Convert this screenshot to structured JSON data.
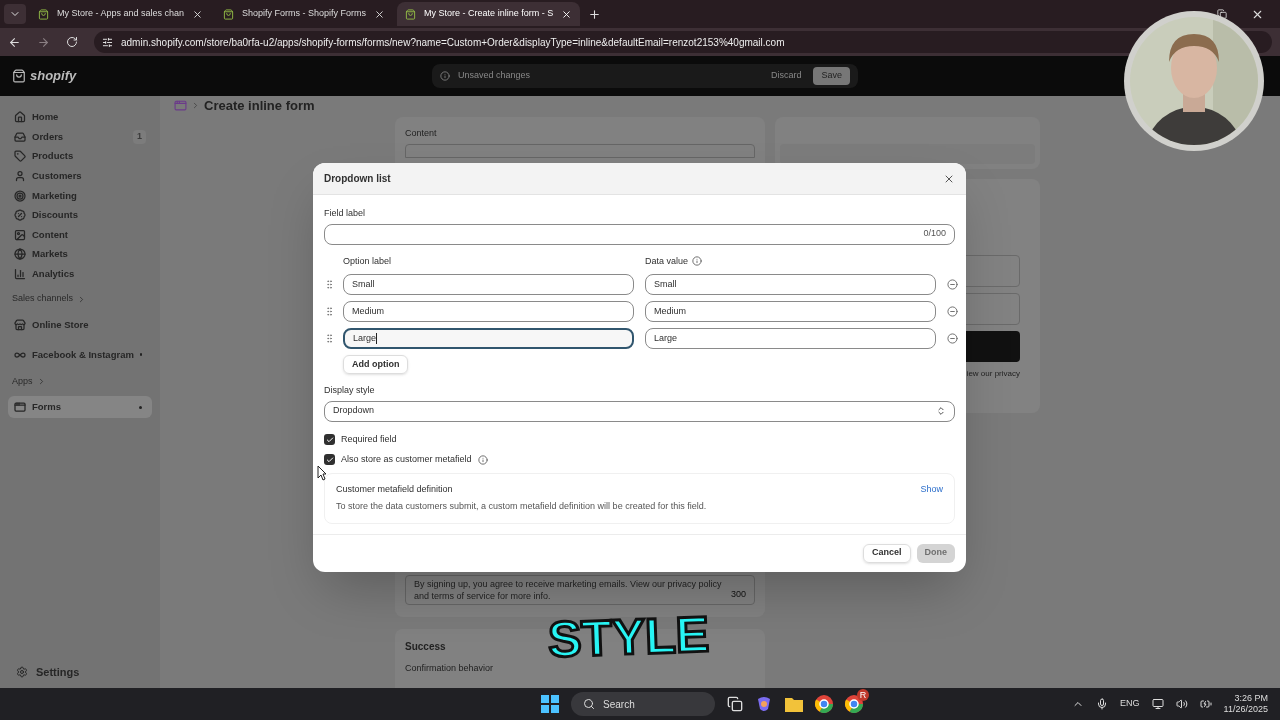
{
  "browser": {
    "tabs": [
      {
        "title": "My Store - Apps and sales chan",
        "selected": false
      },
      {
        "title": "Shopify Forms - Shopify Forms",
        "selected": false
      },
      {
        "title": "My Store - Create inline form - S",
        "selected": true
      }
    ],
    "url": "admin.shopify.com/store/ba0rfa-u2/apps/shopify-forms/forms/new?name=Custom+Order&displayType=inline&defaultEmail=renzot2153%40gmail.com"
  },
  "topbar": {
    "logo": "shopify",
    "status": "Unsaved changes",
    "discard": "Discard",
    "save": "Save"
  },
  "sidebar": {
    "items": [
      {
        "label": "Home",
        "selected": false
      },
      {
        "label": "Orders",
        "badge": "1",
        "selected": false
      },
      {
        "label": "Products",
        "selected": false
      },
      {
        "label": "Customers",
        "selected": false
      },
      {
        "label": "Marketing",
        "selected": false
      },
      {
        "label": "Discounts",
        "selected": false
      },
      {
        "label": "Content",
        "selected": false
      },
      {
        "label": "Markets",
        "selected": false
      },
      {
        "label": "Analytics",
        "selected": false
      }
    ],
    "sections": [
      {
        "heading": "Sales channels",
        "items": [
          {
            "label": "Online Store",
            "dot": false,
            "selected": false
          },
          {
            "label": "Facebook & Instagram",
            "dot": true,
            "selected": false
          }
        ]
      },
      {
        "heading": "Apps",
        "items": [
          {
            "label": "Forms",
            "dot": true,
            "selected": true
          }
        ]
      }
    ],
    "settings": "Settings"
  },
  "page": {
    "title": "Create inline form",
    "content_label": "Content",
    "disclaimer": "By signing up, you agree to receive marketing emails. View our privacy policy and terms of service for more info.",
    "counter": "300",
    "success_title": "Success",
    "success_label": "Confirmation behavior",
    "preview_text": "iew our privacy"
  },
  "modal": {
    "title": "Dropdown list",
    "field_label": {
      "label": "Field label",
      "counter": "0/100"
    },
    "columns": [
      "Option label",
      "Data value"
    ],
    "options": [
      {
        "label": "Small",
        "value": "Small",
        "focused": false
      },
      {
        "label": "Medium",
        "value": "Medium",
        "focused": false
      },
      {
        "label": "Large",
        "value": "Large",
        "focused": true
      }
    ],
    "add_option": "Add option",
    "display_style": {
      "label": "Display style",
      "value": "Dropdown"
    },
    "checkboxes": [
      {
        "label": "Required field",
        "checked": true,
        "info": false
      },
      {
        "label": "Also store as customer metafield",
        "checked": true,
        "info": true
      }
    ],
    "metafield": {
      "title": "Customer metafield definition",
      "description": "To store the data customers submit, a custom metafield definition will be created for this field.",
      "link": "Show"
    },
    "buttons": [
      {
        "label": "Cancel",
        "disabled": false
      },
      {
        "label": "Done",
        "disabled": true
      }
    ]
  },
  "caption": "STYLE",
  "taskbar": {
    "search": "Search",
    "badge": "R",
    "language": "ENG",
    "time": "3:26 PM",
    "date": "11/26/2025"
  }
}
